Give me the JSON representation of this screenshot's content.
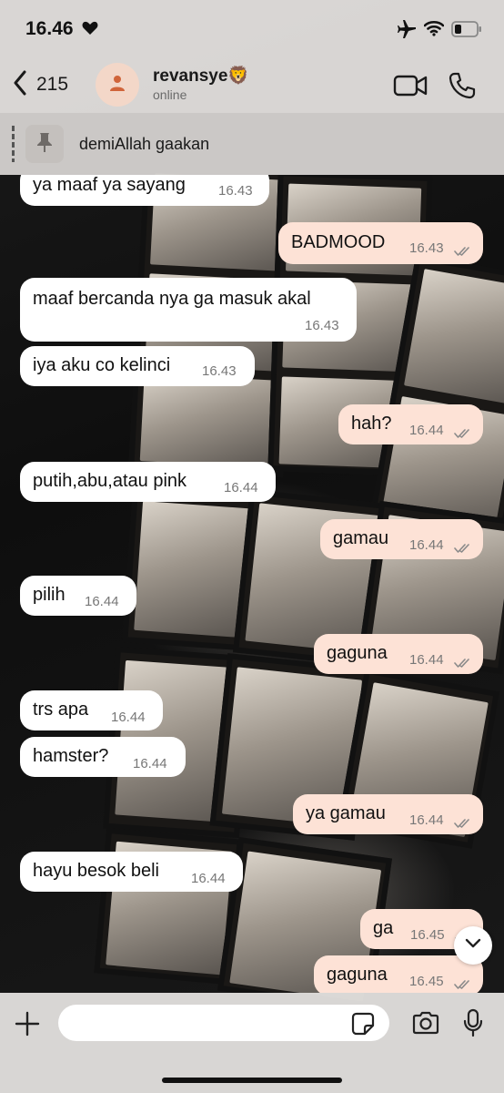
{
  "status_bar": {
    "time": "16.46",
    "icons": [
      "heart-icon",
      "airplane-icon",
      "wifi-icon",
      "battery-icon"
    ]
  },
  "header": {
    "back_count": "215",
    "contact_name": "revansye🦁",
    "contact_status": "online",
    "icons": [
      "chevron-left-icon",
      "person-icon",
      "video-icon",
      "phone-icon"
    ]
  },
  "pinned": {
    "text": "demiAllah gaakan",
    "icon": "pin-icon"
  },
  "messages": [
    {
      "dir": "in",
      "text": "ya maaf ya sayang",
      "time": "16.43"
    },
    {
      "dir": "out",
      "text": "BADMOOD",
      "time": "16.43",
      "read": true
    },
    {
      "dir": "in",
      "text": "maaf bercanda nya ga masuk akal",
      "time": "16.43"
    },
    {
      "dir": "in",
      "text": "iya aku co kelinci",
      "time": "16.43"
    },
    {
      "dir": "out",
      "text": "hah?",
      "time": "16.44",
      "read": true
    },
    {
      "dir": "in",
      "text": "putih,abu,atau pink",
      "time": "16.44"
    },
    {
      "dir": "out",
      "text": "gamau",
      "time": "16.44",
      "read": true
    },
    {
      "dir": "in",
      "text": "pilih",
      "time": "16.44"
    },
    {
      "dir": "out",
      "text": "gaguna",
      "time": "16.44",
      "read": true
    },
    {
      "dir": "in",
      "text": "trs apa",
      "time": "16.44"
    },
    {
      "dir": "in",
      "text": "hamster?",
      "time": "16.44"
    },
    {
      "dir": "out",
      "text": "ya gamau",
      "time": "16.44",
      "read": true
    },
    {
      "dir": "in",
      "text": "hayu besok beli",
      "time": "16.44"
    },
    {
      "dir": "out",
      "text": "ga",
      "time": "16.45",
      "read": true
    },
    {
      "dir": "out",
      "text": "gaguna",
      "time": "16.45",
      "read": true
    }
  ],
  "composer": {
    "placeholder": "",
    "icons": [
      "plus-icon",
      "sticker-icon",
      "camera-icon",
      "microphone-icon"
    ]
  },
  "colors": {
    "incoming_bubble": "#ffffff",
    "outgoing_bubble": "#fde2d6",
    "bar_background": "#e1dedc",
    "read_tick": "#8a8a8a"
  }
}
